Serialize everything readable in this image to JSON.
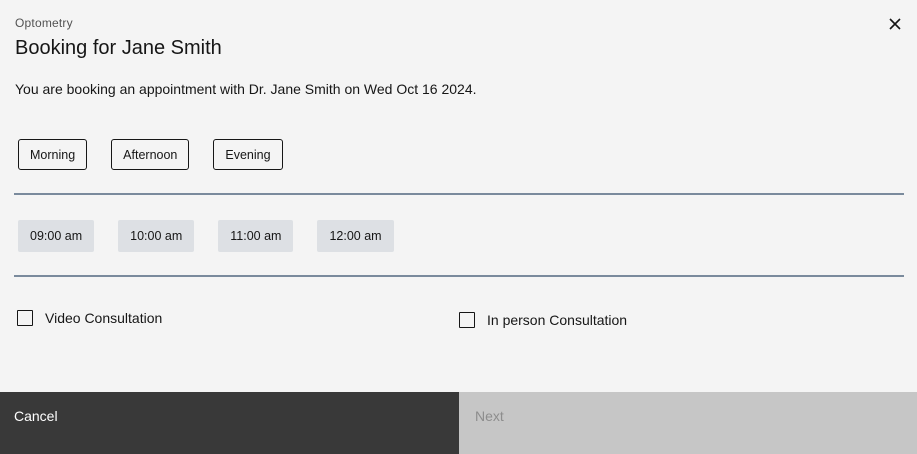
{
  "header": {
    "label": "Optometry",
    "title": "Booking for Jane Smith",
    "close_icon": "close-icon"
  },
  "description": "You are booking an appointment with Dr. Jane Smith on Wed Oct 16 2024.",
  "periods": [
    {
      "label": "Morning"
    },
    {
      "label": "Afternoon"
    },
    {
      "label": "Evening"
    }
  ],
  "slots": [
    {
      "label": "09:00 am"
    },
    {
      "label": "10:00 am"
    },
    {
      "label": "11:00 am"
    },
    {
      "label": "12:00 am"
    }
  ],
  "consultation": {
    "video_label": "Video Consultation",
    "video_checked": false,
    "in_person_label": "In person Consultation",
    "in_person_checked": false
  },
  "footer": {
    "cancel_label": "Cancel",
    "next_label": "Next",
    "next_disabled": true
  },
  "colors": {
    "background": "#f4f4f4",
    "cancel_bg": "#393939",
    "next_disabled_bg": "#c6c6c6",
    "slot_bg": "#dde0e4",
    "divider": "#7a8a9c"
  }
}
